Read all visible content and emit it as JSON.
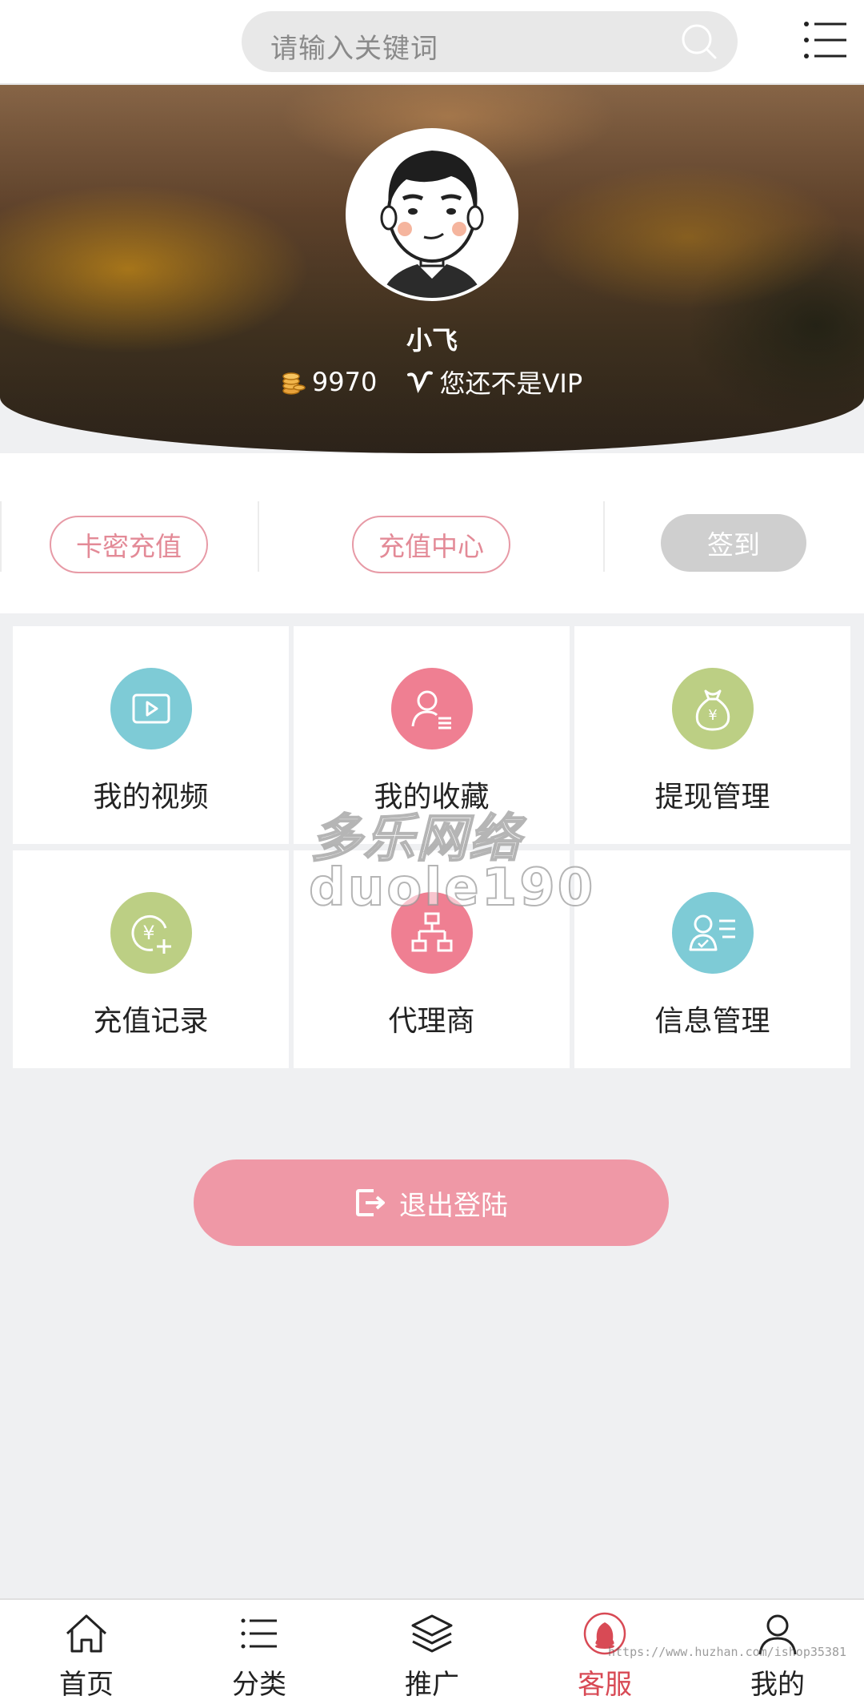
{
  "search": {
    "placeholder": "请输入关键词"
  },
  "profile": {
    "name": "小飞",
    "coins": "9970",
    "vip_status": "您还不是VIP"
  },
  "actions": {
    "card_recharge": "卡密充值",
    "recharge_center": "充值中心",
    "sign_in": "签到"
  },
  "grid": [
    {
      "label": "我的视频",
      "icon": "video-icon",
      "color": "#7ecbd6"
    },
    {
      "label": "我的收藏",
      "icon": "user-list-icon",
      "color": "#ef7f92"
    },
    {
      "label": "提现管理",
      "icon": "money-bag-icon",
      "color": "#bccf84"
    },
    {
      "label": "充值记录",
      "icon": "yen-plus-icon",
      "color": "#bccf84"
    },
    {
      "label": "代理商",
      "icon": "hierarchy-icon",
      "color": "#ef7f92"
    },
    {
      "label": "信息管理",
      "icon": "user-card-icon",
      "color": "#7ecbd6"
    }
  ],
  "watermark": {
    "line1": "多乐网络",
    "line2": "duole190",
    "url": "https://www.huzhan.com/ishop35381"
  },
  "logout": {
    "label": "退出登陆"
  },
  "nav": [
    {
      "label": "首页",
      "icon": "home-icon"
    },
    {
      "label": "分类",
      "icon": "list-icon"
    },
    {
      "label": "推广",
      "icon": "layers-icon"
    },
    {
      "label": "客服",
      "icon": "qq-icon",
      "active": true
    },
    {
      "label": "我的",
      "icon": "person-icon"
    }
  ],
  "colors": {
    "accent": "#ef98a6",
    "active_nav": "#d84a55"
  }
}
